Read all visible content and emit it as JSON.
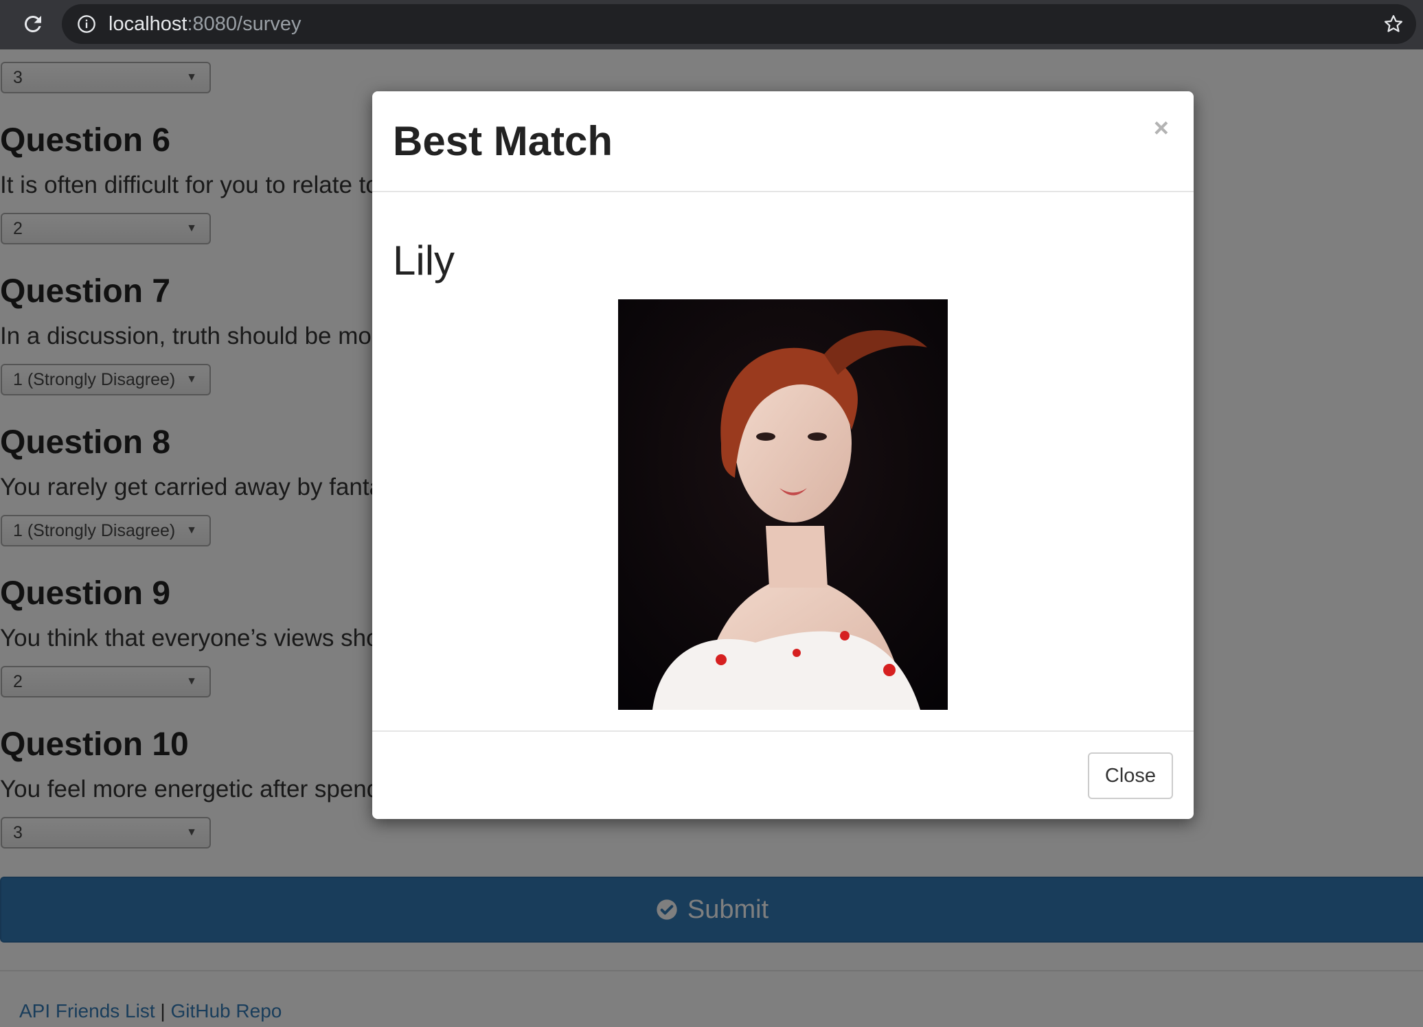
{
  "browser": {
    "url_host": "localhost",
    "url_path": ":8080/survey"
  },
  "survey": {
    "q5_answer": "3",
    "questions": [
      {
        "title": "Question 6",
        "text": "It is often difficult for you to relate to other people's feelings.",
        "answer": "2"
      },
      {
        "title": "Question 7",
        "text": "In a discussion, truth should be more important than people's sensitivities.",
        "answer": "1 (Strongly Disagree)"
      },
      {
        "title": "Question 8",
        "text": "You rarely get carried away by fantasies and ideas.",
        "answer": "1 (Strongly Disagree)"
      },
      {
        "title": "Question 9",
        "text": "You think that everyone’s views should be respected regardless of whether they are supported by facts or not.",
        "answer": "2"
      },
      {
        "title": "Question 10",
        "text": "You feel more energetic after spending time with a group of people.",
        "answer": "3"
      }
    ],
    "submit_label": "Submit"
  },
  "footer": {
    "link1": "API Friends List",
    "separator": "|",
    "link2": "GitHub Repo"
  },
  "modal": {
    "title": "Best Match",
    "close_x": "×",
    "match_name": "Lily",
    "close_label": "Close"
  },
  "colors": {
    "primary": "#337ab7",
    "chrome": "#35363a",
    "omnibox": "#202124"
  }
}
